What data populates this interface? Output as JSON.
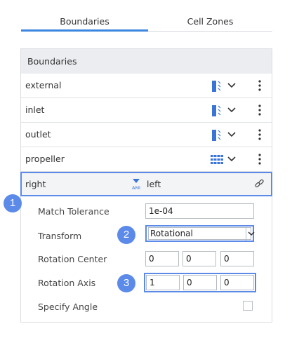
{
  "tabs": [
    {
      "label": "Boundaries",
      "active": true
    },
    {
      "label": "Cell Zones",
      "active": false
    }
  ],
  "panel": {
    "title": "Boundaries",
    "rows": [
      {
        "name": "external",
        "icon": "patch-icon"
      },
      {
        "name": "inlet",
        "icon": "patch-icon"
      },
      {
        "name": "outlet",
        "icon": "patch-icon"
      },
      {
        "name": "propeller",
        "icon": "wall-grid-icon"
      }
    ],
    "pair": {
      "left": "right",
      "right": "left",
      "mid_icon": "ami-icon",
      "mid_icon_text": "AMI",
      "link_icon": "link-icon"
    },
    "form": {
      "match_tolerance_label": "Match Tolerance",
      "match_tolerance_value": "1e-04",
      "transform_label": "Transform",
      "transform_value": "Rotational",
      "rotation_center_label": "Rotation Center",
      "rotation_center": [
        "0",
        "0",
        "0"
      ],
      "rotation_axis_label": "Rotation Axis",
      "rotation_axis": [
        "1",
        "0",
        "0"
      ],
      "specify_angle_label": "Specify Angle",
      "specify_angle_checked": false
    }
  },
  "badges": [
    "1",
    "2",
    "3"
  ],
  "colors": {
    "accent": "#3c86e0",
    "highlight": "#5b8ae8",
    "header_bg": "#ebedf0",
    "icon_blue": "#3a74d6"
  }
}
